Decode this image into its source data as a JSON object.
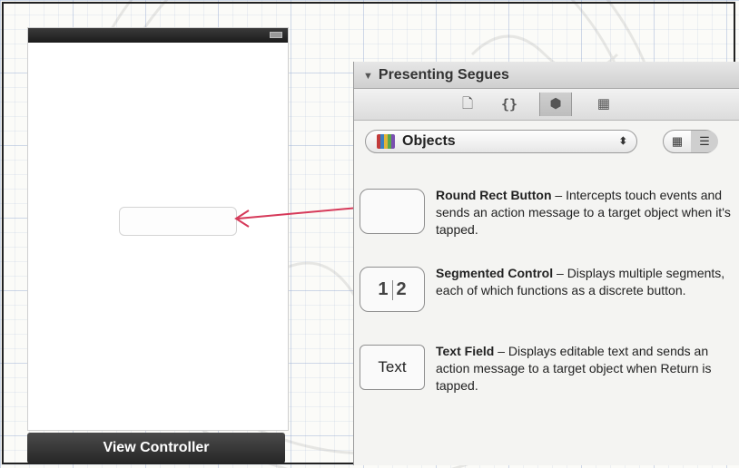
{
  "scene": {
    "label": "View Controller"
  },
  "library": {
    "header_title": "Presenting Segues",
    "tabs": [
      {
        "icon": "file-template-icon",
        "glyph": "🗋"
      },
      {
        "icon": "code-snippet-icon",
        "glyph": "{}"
      },
      {
        "icon": "object-cube-icon",
        "glyph": "⬢"
      },
      {
        "icon": "media-icon",
        "glyph": "▦"
      }
    ],
    "selected_tab": "object-cube-icon",
    "category_select": "Objects",
    "items": [
      {
        "thumbnail": "",
        "title": "Round Rect Button",
        "description": " – Intercepts touch events and sends an action message to a target object when it's tapped."
      },
      {
        "thumbnail": "1 2",
        "seg1": "1",
        "seg2": "2",
        "title": "Segmented Control",
        "description": " – Displays multiple segments, each of which functions as a discrete button."
      },
      {
        "thumbnail": "Text",
        "title": "Text Field",
        "description": " – Displays editable text and sends an action message to a target object when Return is tapped."
      }
    ]
  },
  "colors": {
    "arrow": "#d63a5a",
    "status_bar": "#2a2a2a"
  }
}
